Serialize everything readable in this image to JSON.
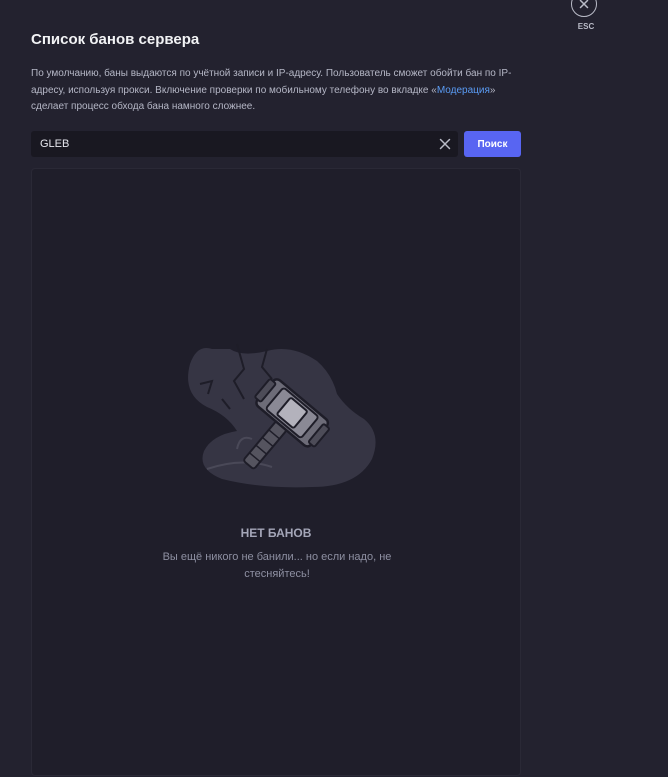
{
  "modal": {
    "title": "Список банов сервера",
    "description_part1": "По умолчанию, баны выдаются по учётной записи и IP-адресу. Пользователь сможет обойти бан по IP-адресу, используя прокси. Включение проверки по мобильному телефону во вкладке «",
    "description_link": "Модерация",
    "description_part2": "» сделает процесс обхода бана намного сложнее."
  },
  "search": {
    "value": "GLEB",
    "button_label": "Поиск",
    "clear_icon": "close-icon"
  },
  "empty_state": {
    "title": "НЕТ БАНОВ",
    "description": "Вы ещё никого не банили... но если надо, не стесняйтесь!",
    "illustration": "ban-hammer-illustration"
  },
  "close": {
    "label": "ESC",
    "icon": "close-icon"
  },
  "colors": {
    "background": "#23222f",
    "panel": "#1f1e2a",
    "accent": "#5865f2",
    "link": "#5a9cf5"
  }
}
